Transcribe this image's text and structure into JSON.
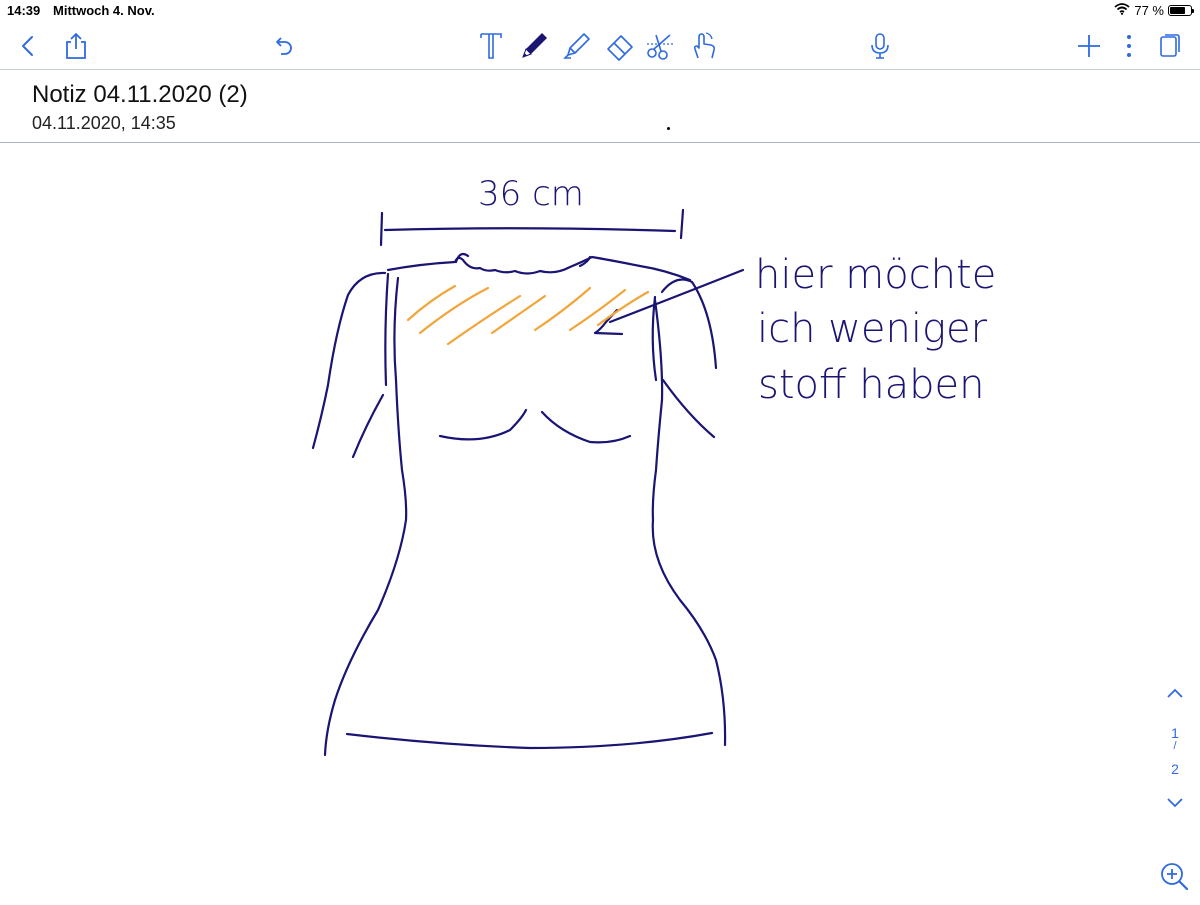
{
  "status": {
    "time": "14:39",
    "date": "Mittwoch 4. Nov.",
    "battery": "77 %",
    "battery_level": 0.77
  },
  "toolbar": {
    "icons": [
      "back-chevron-icon",
      "share-icon",
      "undo-icon",
      "text-tool-icon",
      "pen-icon",
      "highlighter-icon",
      "eraser-icon",
      "scissors-icon",
      "hand-touch-icon",
      "microphone-icon",
      "plus-icon",
      "more-vertical-icon",
      "page-icon"
    ],
    "accent": "#2f6ae0"
  },
  "note": {
    "title": "Notiz 04.11.2020 (2)",
    "timestamp": "04.11.2020, 14:35"
  },
  "sketch": {
    "measurement": "36 cm",
    "annotation_lines": [
      "hier möchte",
      "ich weniger",
      "stoff haben"
    ],
    "ink_color": "#1a1473",
    "highlight_color": "#f2a53a"
  },
  "pager": {
    "current": "1",
    "separator": "/",
    "total": "2"
  }
}
